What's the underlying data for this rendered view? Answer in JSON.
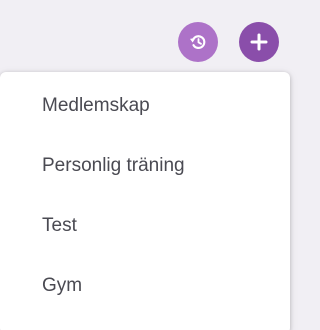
{
  "actions": {
    "history_icon": "history-icon",
    "add_icon": "plus-icon",
    "history_color": "#ad72c8",
    "add_color": "#8a4eaa"
  },
  "menu": {
    "items": [
      {
        "label": "Medlemskap"
      },
      {
        "label": "Personlig träning"
      },
      {
        "label": "Test"
      },
      {
        "label": "Gym"
      }
    ]
  }
}
